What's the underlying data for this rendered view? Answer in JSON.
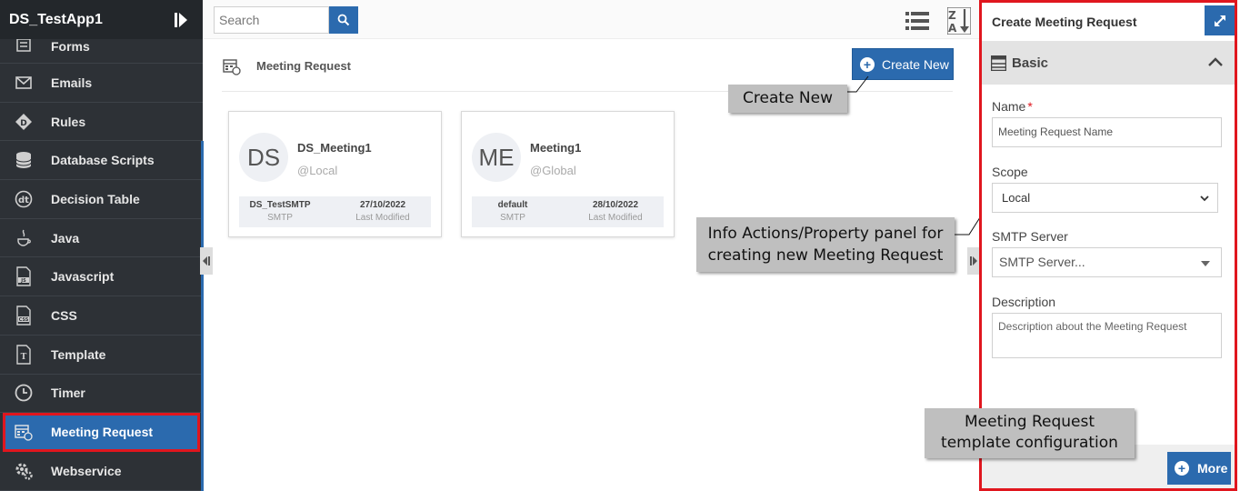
{
  "app": {
    "title": "DS_TestApp1"
  },
  "sidebar": {
    "items": [
      {
        "label": "Forms",
        "icon": "form-icon"
      },
      {
        "label": "Emails",
        "icon": "email-icon"
      },
      {
        "label": "Rules",
        "icon": "rules-icon"
      },
      {
        "label": "Database Scripts",
        "icon": "database-icon"
      },
      {
        "label": "Decision Table",
        "icon": "decision-table-icon"
      },
      {
        "label": "Java",
        "icon": "java-icon"
      },
      {
        "label": "Javascript",
        "icon": "javascript-icon"
      },
      {
        "label": "CSS",
        "icon": "css-icon"
      },
      {
        "label": "Template",
        "icon": "template-icon"
      },
      {
        "label": "Timer",
        "icon": "timer-icon"
      },
      {
        "label": "Meeting Request",
        "icon": "meeting-request-icon",
        "active": true
      },
      {
        "label": "Webservice",
        "icon": "webservice-icon"
      }
    ]
  },
  "toolbar": {
    "search_placeholder": "Search"
  },
  "section": {
    "title": "Meeting Request",
    "create_label": "Create New"
  },
  "cards": [
    {
      "initials": "DS",
      "name": "DS_Meeting1",
      "scope": "@Local",
      "smtp": "DS_TestSMTP",
      "smtp_label": "SMTP",
      "modified": "27/10/2022",
      "modified_label": "Last Modified"
    },
    {
      "initials": "ME",
      "name": "Meeting1",
      "scope": "@Global",
      "smtp": "default",
      "smtp_label": "SMTP",
      "modified": "28/10/2022",
      "modified_label": "Last Modified"
    }
  ],
  "callouts": {
    "create_new": "Create New",
    "info_panel_line1": "Info Actions/Property panel for",
    "info_panel_line2": "creating new Meeting Request",
    "template_line1": "Meeting Request",
    "template_line2": "template configuration"
  },
  "panel": {
    "title": "Create Meeting Request",
    "section_title": "Basic",
    "name_label": "Name",
    "name_required": "*",
    "name_placeholder": "Meeting Request Name",
    "scope_label": "Scope",
    "scope_value": "Local",
    "smtp_label": "SMTP Server",
    "smtp_placeholder": "SMTP Server...",
    "description_label": "Description",
    "description_placeholder": "Description about the Meeting Request",
    "more_label": "More"
  },
  "colors": {
    "accent": "#2b6aae",
    "highlight": "#e0161e",
    "sidebar_bg": "#2d3136"
  }
}
